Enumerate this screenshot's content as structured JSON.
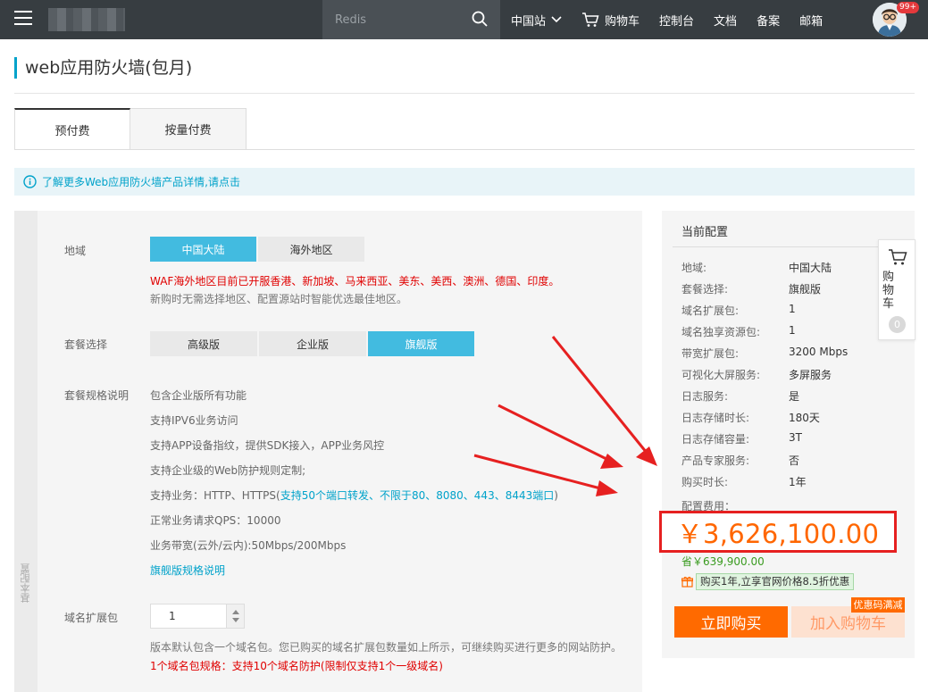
{
  "nav": {
    "search_placeholder": "Redis",
    "region": "中国站",
    "cart": "购物车",
    "console": "控制台",
    "docs": "文档",
    "beian": "备案",
    "mail": "邮箱",
    "badge": "99+"
  },
  "page": {
    "title": "web应用防火墙(包月)"
  },
  "tabs": [
    {
      "label": "预付费",
      "active": true
    },
    {
      "label": "按量付费",
      "active": false
    }
  ],
  "info": {
    "text": "了解更多Web应用防火墙产品详情,请点击"
  },
  "config": {
    "side_label": "基本配置",
    "region": {
      "label": "地域",
      "options": [
        "中国大陆",
        "海外地区"
      ],
      "selected": "中国大陆",
      "note_red": "WAF海外地区目前已开服香港、新加坡、马来西亚、美东、美西、澳洲、德国、印度。",
      "note_grey": "新购时无需选择地区、配置源站时智能优选最佳地区。"
    },
    "package": {
      "label": "套餐选择",
      "options": [
        "高级版",
        "企业版",
        "旗舰版"
      ],
      "selected": "旗舰版"
    },
    "spec": {
      "label": "套餐规格说明",
      "lines": [
        "包含企业版所有功能",
        "支持IPV6业务访问",
        "支持APP设备指纹，提供SDK接入，APP业务风控",
        "支持企业级的Web防护规则定制;"
      ],
      "protocols_prefix": "支持业务：HTTP、HTTPS(",
      "protocols_link": "支持50个端口转发、不限于80、8080、443、8443端口",
      "protocols_suffix": ")",
      "qps": "正常业务请求QPS：10000",
      "bandwidth": "业务带宽(云外/云内):50Mbps/200Mbps",
      "more_link": "旗舰版规格说明"
    },
    "domain": {
      "label": "域名扩展包",
      "value": "1",
      "note_grey": "版本默认包含一个域名包。您已购买的域名扩展包数量如上所示，可继续购买进行更多的网站防护。",
      "note_red": "1个域名包规格：支持10个域名防护(限制仅支持1个一级域名)"
    }
  },
  "summary": {
    "title": "当前配置",
    "rows": [
      {
        "k": "地域:",
        "v": "中国大陆"
      },
      {
        "k": "套餐选择:",
        "v": "旗舰版"
      },
      {
        "k": "域名扩展包:",
        "v": "1"
      },
      {
        "k": "域名独享资源包:",
        "v": "1"
      },
      {
        "k": "带宽扩展包:",
        "v": "3200 Mbps"
      },
      {
        "k": "可视化大屏服务:",
        "v": "多屏服务"
      },
      {
        "k": "日志服务:",
        "v": "是"
      },
      {
        "k": "日志存储时长:",
        "v": "180天"
      },
      {
        "k": "日志存储容量:",
        "v": "3T"
      },
      {
        "k": "产品专家服务:",
        "v": "否"
      },
      {
        "k": "购买时长:",
        "v": "1年"
      }
    ],
    "cost_label": "配置费用：",
    "price": "￥3,626,100.00",
    "save": "省￥639,900.00",
    "promo": "购买1年,立享官网价格8.5折优惠",
    "buy": "立即购买",
    "add_cart": "加入购物车",
    "coupon": "优惠码满减"
  },
  "float_cart": {
    "label": "购物车",
    "count": "0"
  },
  "colors": {
    "accent": "#00a2ca",
    "selected": "#42bbe0",
    "buy": "#ff6a00",
    "price": "#ff6600",
    "annotation": "#e62020"
  }
}
